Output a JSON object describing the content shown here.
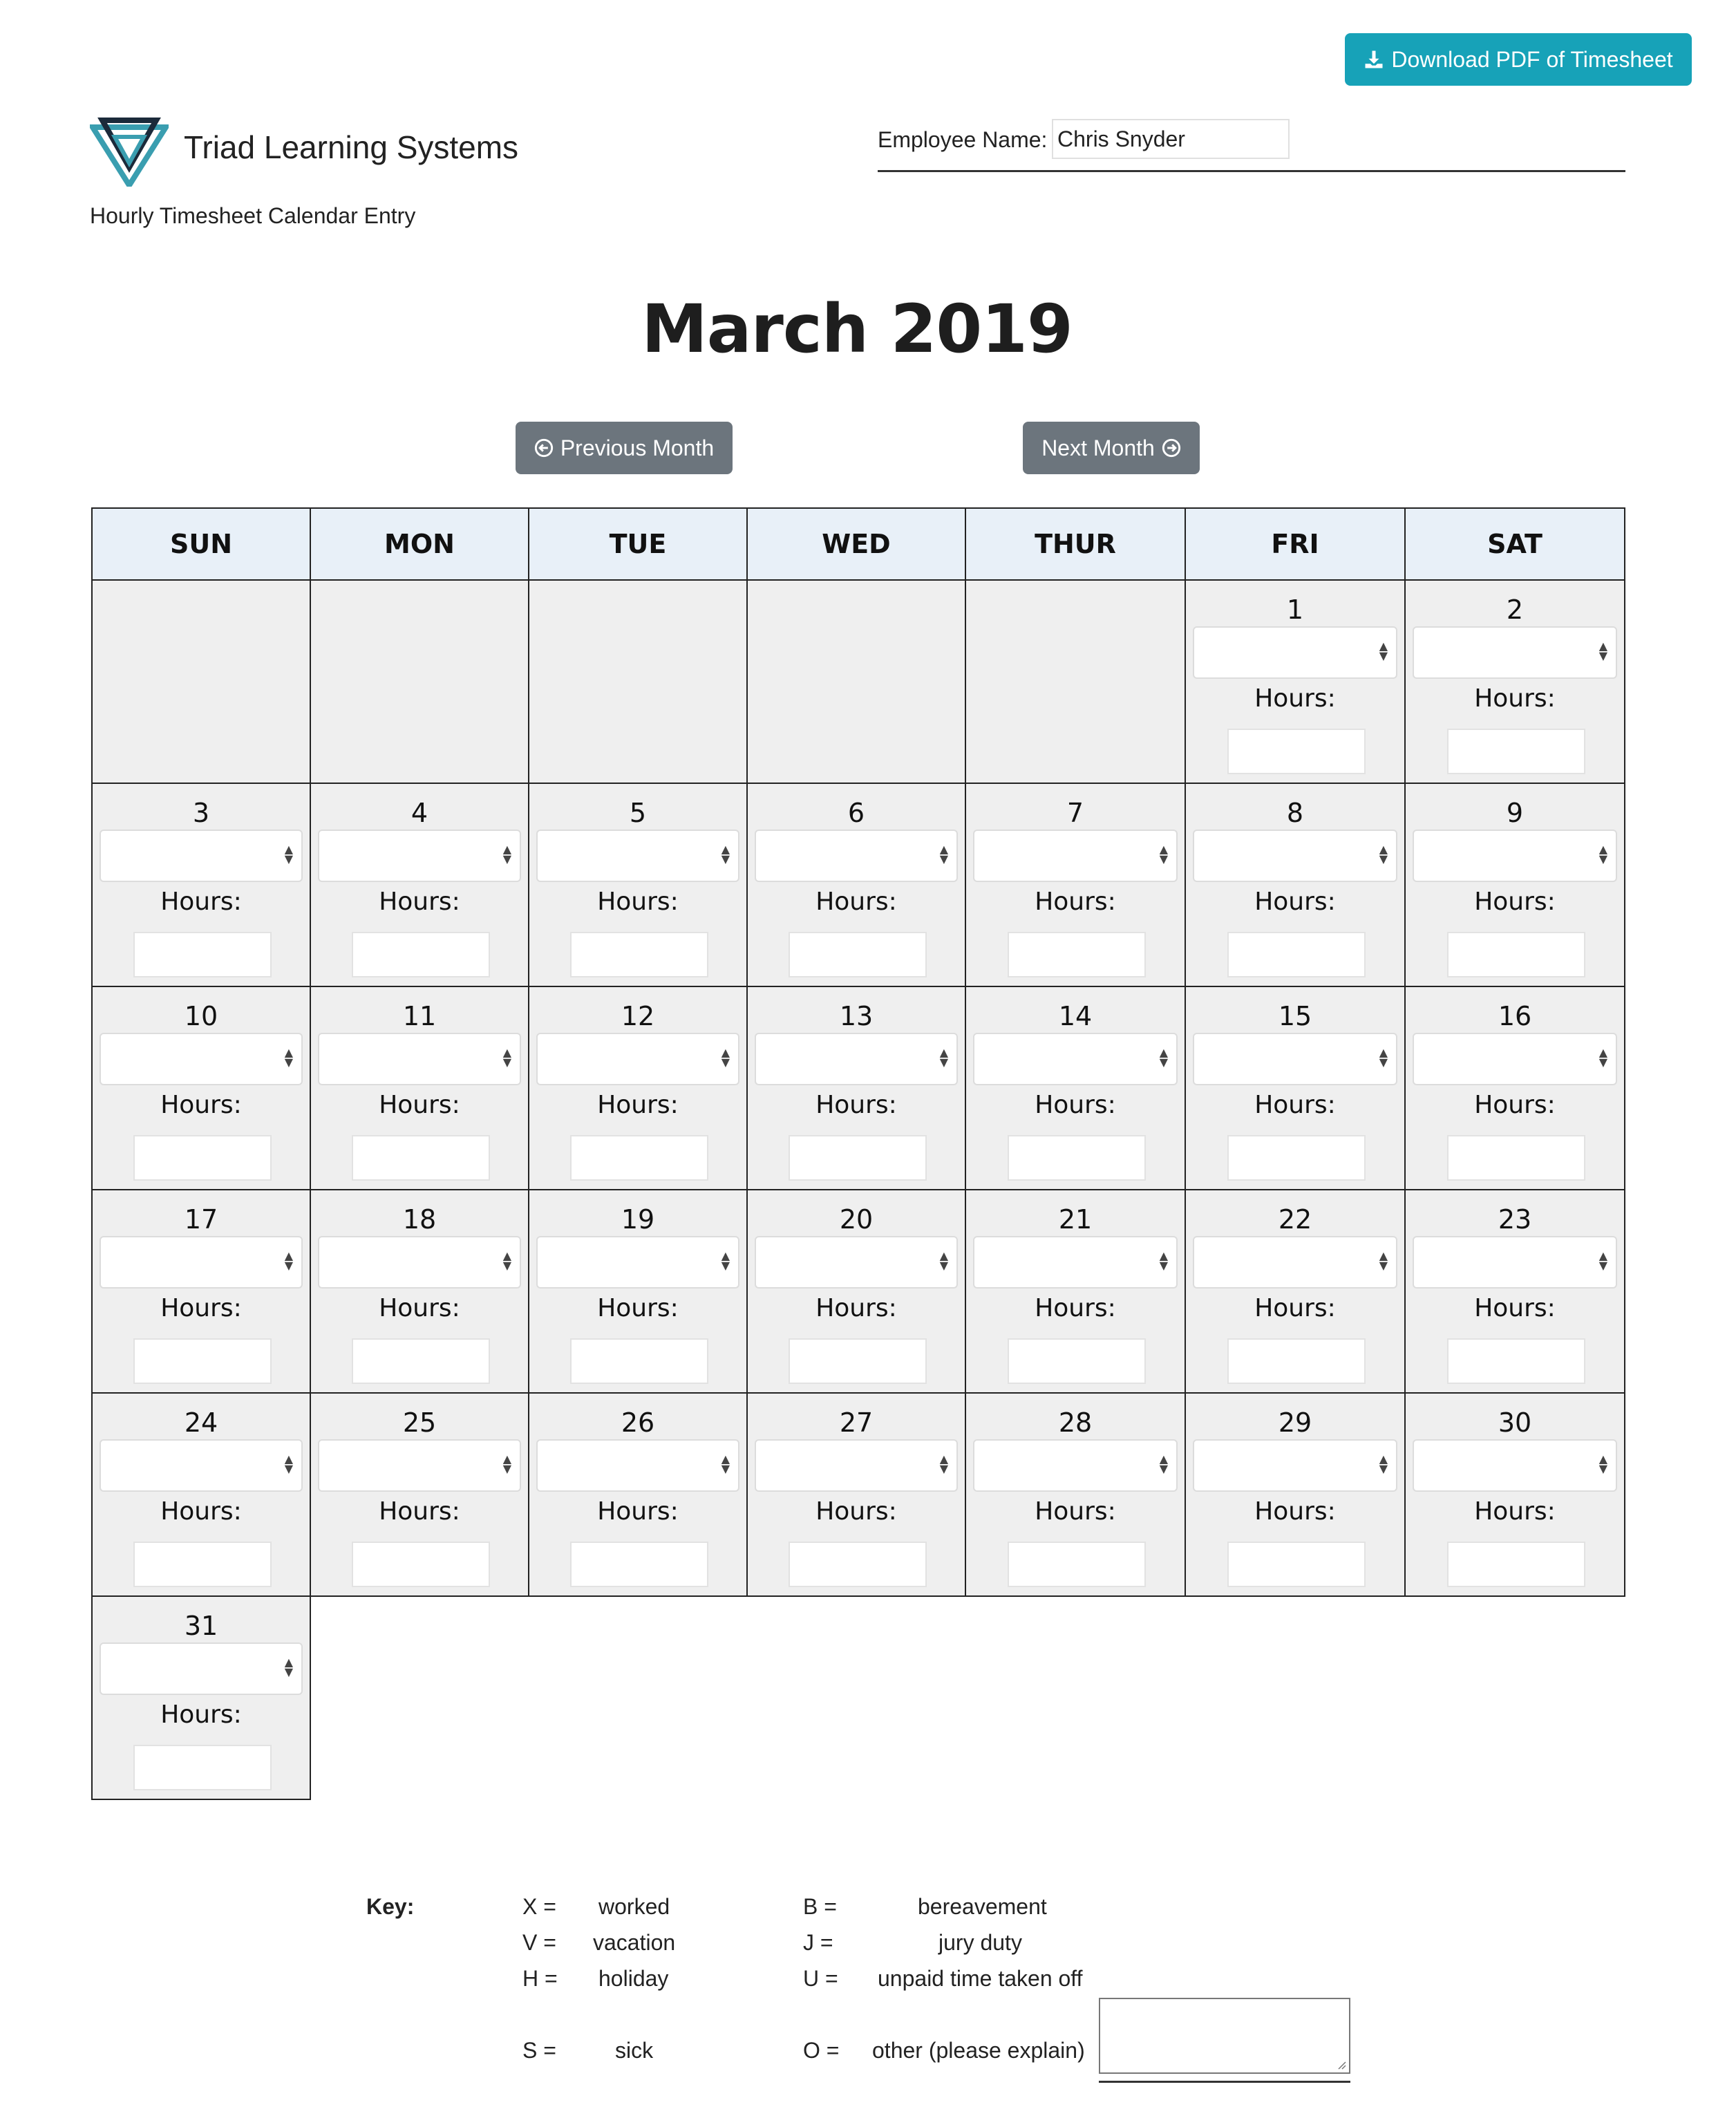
{
  "header": {
    "download_label": "Download PDF of Timesheet",
    "company_name": "Triad Learning Systems",
    "subtitle": "Hourly Timesheet Calendar Entry",
    "employee_label": "Employee Name:",
    "employee_name": "Chris Snyder"
  },
  "calendar": {
    "month_title": "March 2019",
    "prev_label": "Previous Month",
    "next_label": "Next Month",
    "weekdays": [
      "SUN",
      "MON",
      "TUE",
      "WED",
      "THUR",
      "FRI",
      "SAT"
    ],
    "first_weekday_index": 5,
    "days_in_month": 31,
    "hours_label": "Hours:"
  },
  "key": {
    "label": "Key:",
    "items": [
      {
        "code": "X =",
        "meaning": "worked"
      },
      {
        "code": "V =",
        "meaning": "vacation"
      },
      {
        "code": "H =",
        "meaning": "holiday"
      },
      {
        "code": "S =",
        "meaning": "sick"
      },
      {
        "code": "B =",
        "meaning": "bereavement"
      },
      {
        "code": "J =",
        "meaning": "jury duty"
      },
      {
        "code": "U =",
        "meaning": "unpaid time taken off"
      },
      {
        "code": "O =",
        "meaning": "other (please explain)"
      }
    ]
  },
  "colors": {
    "download_button": "#17a2b8",
    "nav_button": "#6c757d",
    "header_row": "#e8f0f8",
    "day_cell": "#efefef",
    "logo_dark": "#1b2a3a",
    "logo_teal": "#3a9eb0"
  },
  "icons": {
    "download": "download-icon",
    "prev": "circle-arrow-left-icon",
    "next": "circle-arrow-right-icon"
  }
}
